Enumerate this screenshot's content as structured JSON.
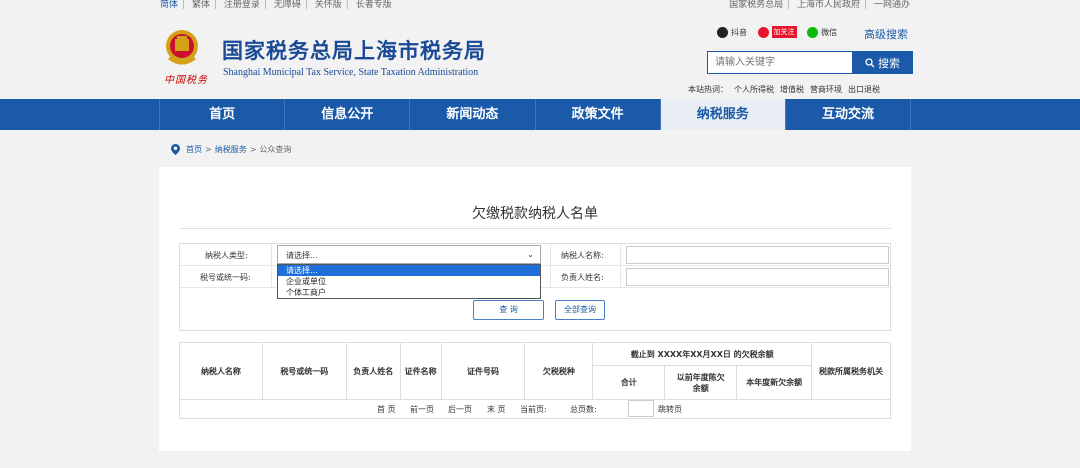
{
  "topbar": {
    "left_links": [
      "简体",
      "繁体",
      "注册登录",
      "无障碍",
      "关怀版",
      "长者专版"
    ],
    "right_links": [
      "国家税务总局",
      "上海市人民政府",
      "一网通办"
    ]
  },
  "header": {
    "emblem_text": "中国税务",
    "title": "国家税务总局上海市税务局",
    "subtitle": "Shanghai Municipal Tax Service, State Taxation Administration",
    "social": {
      "douyin": "抖音",
      "weibo_follow": "加关注",
      "weixin": "微信"
    },
    "advanced_search": "高级搜索",
    "search": {
      "placeholder": "请输入关键字",
      "button": "搜索"
    },
    "hot_label": "本站热词：",
    "hot_words": [
      "个人所得税",
      "增值税",
      "营商环境",
      "出口退税"
    ]
  },
  "nav": {
    "items": [
      "首页",
      "信息公开",
      "新闻动态",
      "政策文件",
      "纳税服务",
      "互动交流"
    ],
    "active": "纳税服务"
  },
  "breadcrumb": {
    "home": "首页",
    "section": "纳税服务",
    "current": "公众查询",
    "separator": ">"
  },
  "page": {
    "title": "欠缴税款纳税人名单",
    "form": {
      "taxpayer_type_label": "纳税人类型:",
      "taxpayer_type_value": "请选择...",
      "taxpayer_type_options": [
        "请选择...",
        "企业或单位",
        "个体工商户"
      ],
      "taxpayer_name_label": "纳税人名称:",
      "tax_id_label": "税号或统一码:",
      "responsible_label": "负责人姓名:",
      "query_button": "查 询",
      "query_all_button": "全部查询"
    },
    "table": {
      "headers": [
        "纳税人名称",
        "税号或统一码",
        "负责人姓名",
        "证件名称",
        "证件号码",
        "欠税税种"
      ],
      "group_header": "截止到 XXXX年XX月XX日 的欠税余额",
      "sub_headers": [
        "合计",
        "以前年度陈欠余额",
        "本年度新欠余额"
      ],
      "last_header": "税款所属税务机关"
    },
    "pager": {
      "first": "首 页",
      "prev": "前一页",
      "next": "后一页",
      "last": "末 页",
      "current": "当前页:",
      "total": "总页数:",
      "goto": "跳转页"
    }
  }
}
